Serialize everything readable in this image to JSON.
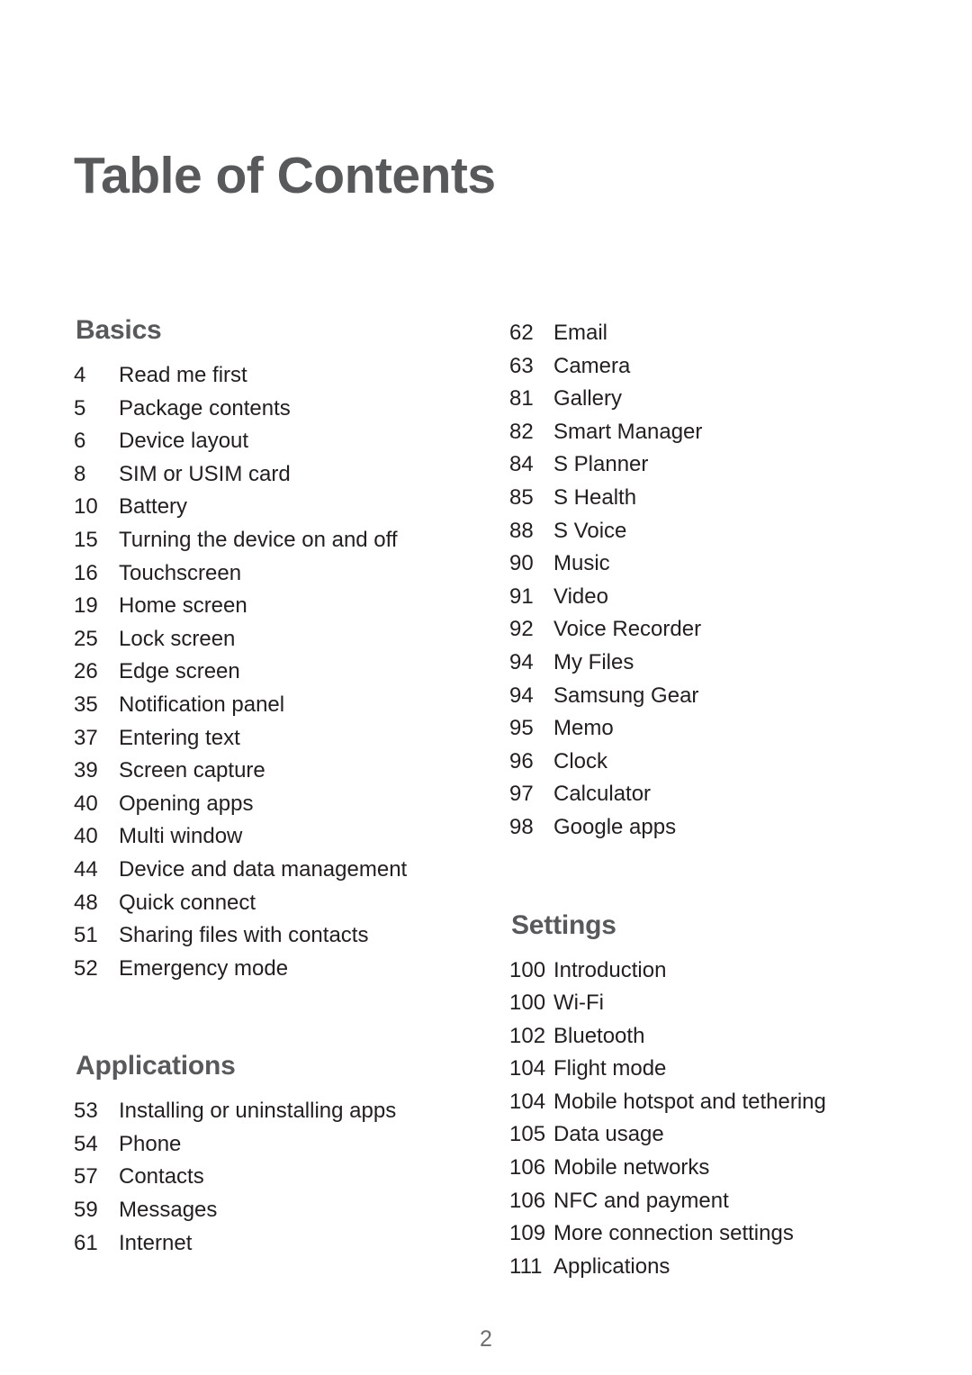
{
  "document": {
    "title": "Table of Contents",
    "page_number": "2",
    "colors": {
      "heading": "#58595B",
      "body_text": "#231F20",
      "page_number": "#6D6E71",
      "background": "#FFFFFF"
    }
  },
  "columns": [
    {
      "id": "left",
      "sections": [
        {
          "heading": "Basics",
          "entries": [
            {
              "page": "4",
              "title": "Read me first"
            },
            {
              "page": "5",
              "title": "Package contents"
            },
            {
              "page": "6",
              "title": "Device layout"
            },
            {
              "page": "8",
              "title": "SIM or USIM card"
            },
            {
              "page": "10",
              "title": "Battery"
            },
            {
              "page": "15",
              "title": "Turning the device on and off"
            },
            {
              "page": "16",
              "title": "Touchscreen"
            },
            {
              "page": "19",
              "title": "Home screen"
            },
            {
              "page": "25",
              "title": "Lock screen"
            },
            {
              "page": "26",
              "title": "Edge screen"
            },
            {
              "page": "35",
              "title": "Notification panel"
            },
            {
              "page": "37",
              "title": "Entering text"
            },
            {
              "page": "39",
              "title": "Screen capture"
            },
            {
              "page": "40",
              "title": "Opening apps"
            },
            {
              "page": "40",
              "title": "Multi window"
            },
            {
              "page": "44",
              "title": "Device and data management"
            },
            {
              "page": "48",
              "title": "Quick connect"
            },
            {
              "page": "51",
              "title": "Sharing files with contacts"
            },
            {
              "page": "52",
              "title": "Emergency mode"
            }
          ]
        },
        {
          "heading": "Applications",
          "entries": [
            {
              "page": "53",
              "title": "Installing or uninstalling apps"
            },
            {
              "page": "54",
              "title": "Phone"
            },
            {
              "page": "57",
              "title": "Contacts"
            },
            {
              "page": "59",
              "title": "Messages"
            },
            {
              "page": "61",
              "title": "Internet"
            }
          ]
        }
      ]
    },
    {
      "id": "right",
      "sections": [
        {
          "heading": "",
          "entries": [
            {
              "page": "62",
              "title": "Email"
            },
            {
              "page": "63",
              "title": "Camera"
            },
            {
              "page": "81",
              "title": "Gallery"
            },
            {
              "page": "82",
              "title": "Smart Manager"
            },
            {
              "page": "84",
              "title": "S Planner"
            },
            {
              "page": "85",
              "title": "S Health"
            },
            {
              "page": "88",
              "title": "S Voice"
            },
            {
              "page": "90",
              "title": "Music"
            },
            {
              "page": "91",
              "title": "Video"
            },
            {
              "page": "92",
              "title": "Voice Recorder"
            },
            {
              "page": "94",
              "title": "My Files"
            },
            {
              "page": "94",
              "title": "Samsung Gear"
            },
            {
              "page": "95",
              "title": "Memo"
            },
            {
              "page": "96",
              "title": "Clock"
            },
            {
              "page": "97",
              "title": "Calculator"
            },
            {
              "page": "98",
              "title": "Google apps"
            }
          ]
        },
        {
          "heading": "Settings",
          "entries": [
            {
              "page": "100",
              "title": "Introduction"
            },
            {
              "page": "100",
              "title": "Wi-Fi"
            },
            {
              "page": "102",
              "title": "Bluetooth"
            },
            {
              "page": "104",
              "title": "Flight mode"
            },
            {
              "page": "104",
              "title": "Mobile hotspot and tethering"
            },
            {
              "page": "105",
              "title": "Data usage"
            },
            {
              "page": "106",
              "title": "Mobile networks"
            },
            {
              "page": "106",
              "title": "NFC and payment"
            },
            {
              "page": "109",
              "title": "More connection settings"
            },
            {
              "page": "111",
              "title": "Applications"
            }
          ]
        }
      ]
    }
  ]
}
